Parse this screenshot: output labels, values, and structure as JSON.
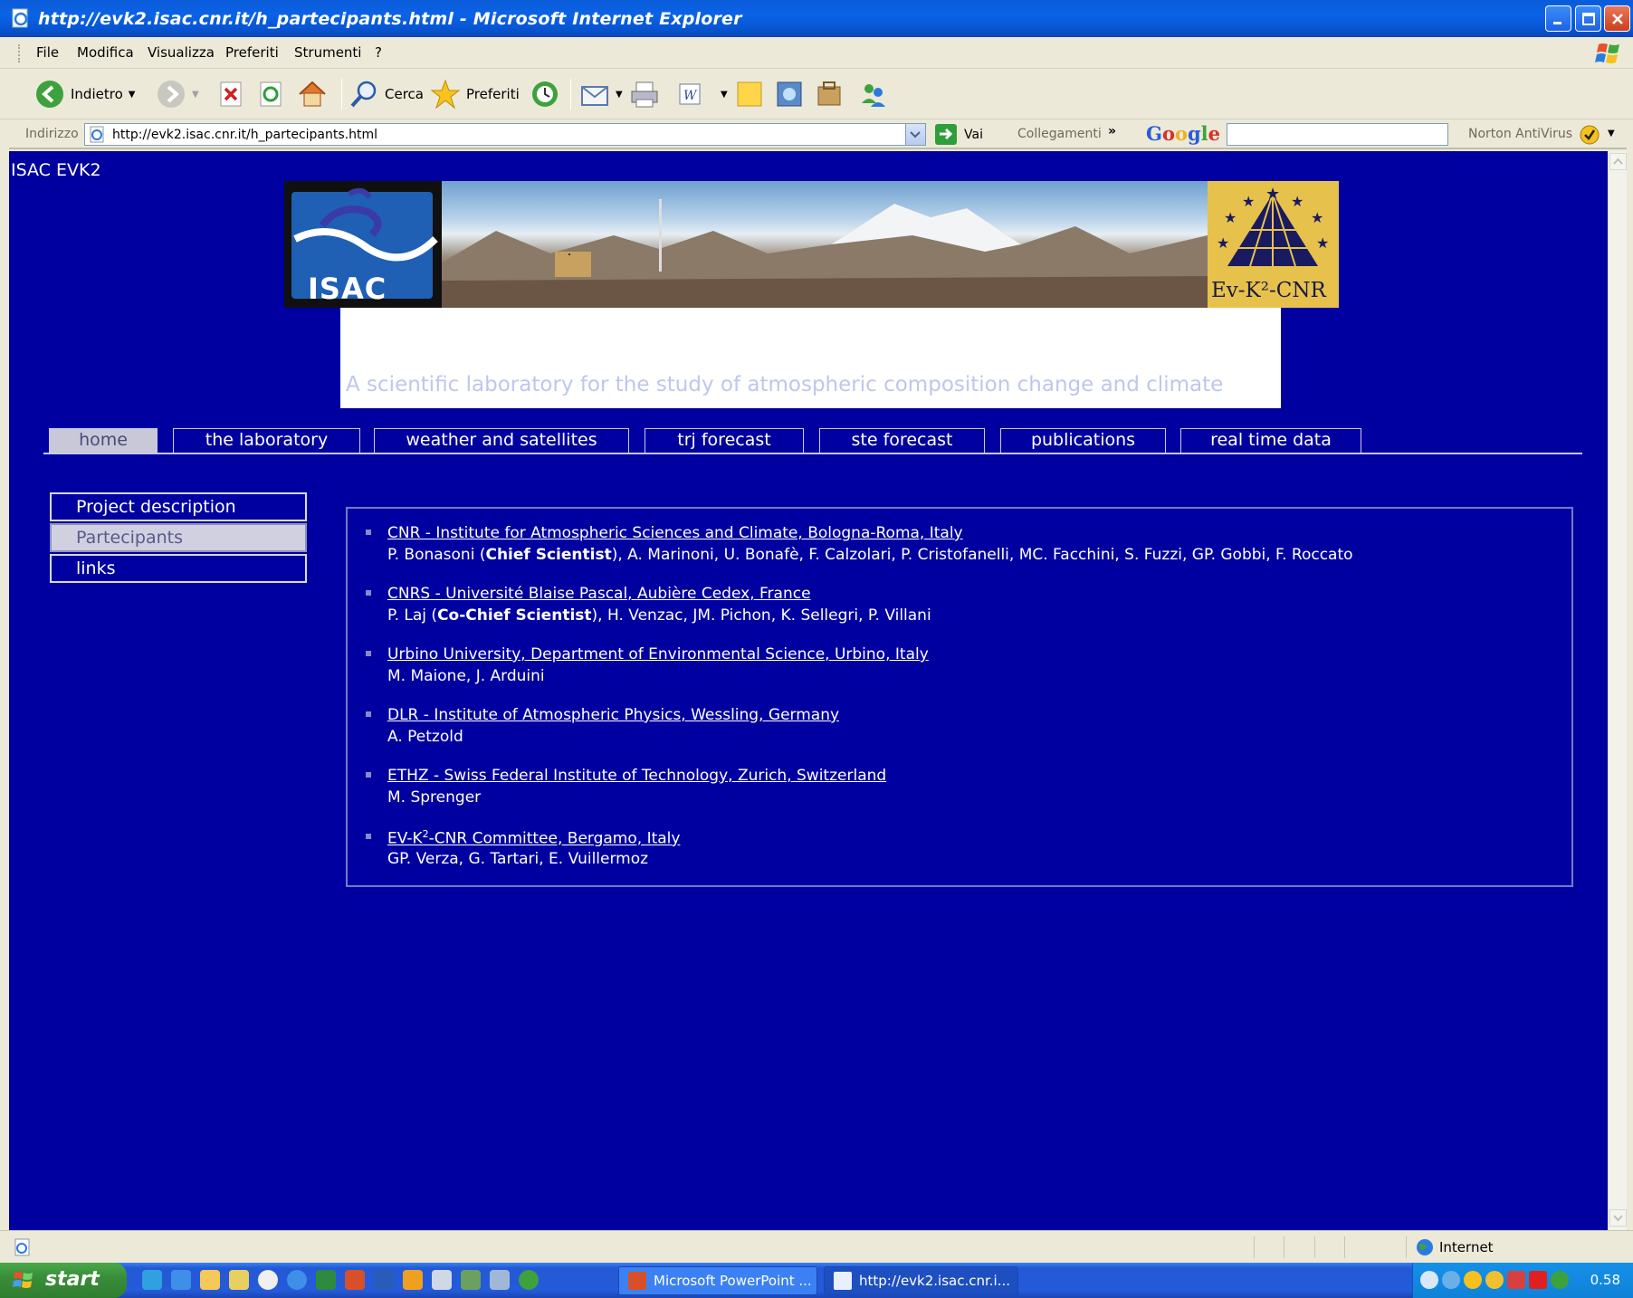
{
  "window": {
    "title": "http://evk2.isac.cnr.it/h_partecipants.html - Microsoft Internet Explorer"
  },
  "menubar": {
    "items": [
      "File",
      "Modifica",
      "Visualizza",
      "Preferiti",
      "Strumenti",
      "?"
    ]
  },
  "toolbar": {
    "back_label": "Indietro",
    "search_label": "Cerca",
    "favorites_label": "Preferiti"
  },
  "addressbar": {
    "label": "Indirizzo",
    "url": "http://evk2.isac.cnr.it/h_partecipants.html",
    "go_label": "Vai",
    "links_label": "Collegamenti",
    "google_label": "Google",
    "norton_label": "Norton AntiVirus"
  },
  "page": {
    "site_name": "ISAC EVK2",
    "isac_logo_text": "ISAC",
    "evk_logo_text": "Ev-K²-CNR",
    "tagline": "A scientific laboratory for the study of atmospheric composition change and climate",
    "nav": [
      {
        "label": "home",
        "active": true
      },
      {
        "label": "the laboratory",
        "active": false
      },
      {
        "label": "weather and satellites",
        "active": false
      },
      {
        "label": "trj forecast",
        "active": false
      },
      {
        "label": "ste forecast",
        "active": false
      },
      {
        "label": "publications",
        "active": false
      },
      {
        "label": "real time data",
        "active": false
      }
    ],
    "side_menu": [
      {
        "label": "Project description",
        "active": false
      },
      {
        "label": "Partecipants",
        "active": true
      },
      {
        "label": "links",
        "active": false
      }
    ],
    "participants": [
      {
        "org": "CNR - Institute for Atmospheric Sciences and Climate, Bologna-Roma, Italy",
        "lead_name": "P. Bonasoni",
        "lead_role": "Chief Scientist",
        "others": "A. Marinoni, U. Bonafè, F. Calzolari, P. Cristofanelli, MC. Facchini, S. Fuzzi, GP. Gobbi, F. Roccato"
      },
      {
        "org": "CNRS - Université Blaise Pascal, Aubière Cedex, France",
        "lead_name": "P. Laj",
        "lead_role": "Co-Chief Scientist",
        "others": "H. Venzac, JM. Pichon, K. Sellegri, P. Villani"
      },
      {
        "org": "Urbino University, Department of Environmental Science, Urbino, Italy",
        "people": "M. Maione, J. Arduini"
      },
      {
        "org": "DLR - Institute of Atmospheric Physics, Wessling, Germany",
        "people": "A. Petzold"
      },
      {
        "org": "ETHZ - Swiss Federal Institute of Technology, Zurich, Switzerland",
        "people": "M. Sprenger"
      },
      {
        "org_prefix": "EV-K",
        "org_sup": "2",
        "org_suffix": "-CNR Committee, Bergamo, Italy",
        "people": "GP. Verza, G. Tartari, E. Vuillermoz"
      }
    ]
  },
  "statusbar": {
    "zone_label": "Internet"
  },
  "taskbar": {
    "start_label": "start",
    "tasks": [
      "Microsoft PowerPoint ...",
      "http://evk2.isac.cnr.i..."
    ],
    "clock": "0.58"
  },
  "colors": {
    "page_background": "#0000A0",
    "active_tab": "#C8C8D8",
    "tagline": "#BFC6EE"
  }
}
